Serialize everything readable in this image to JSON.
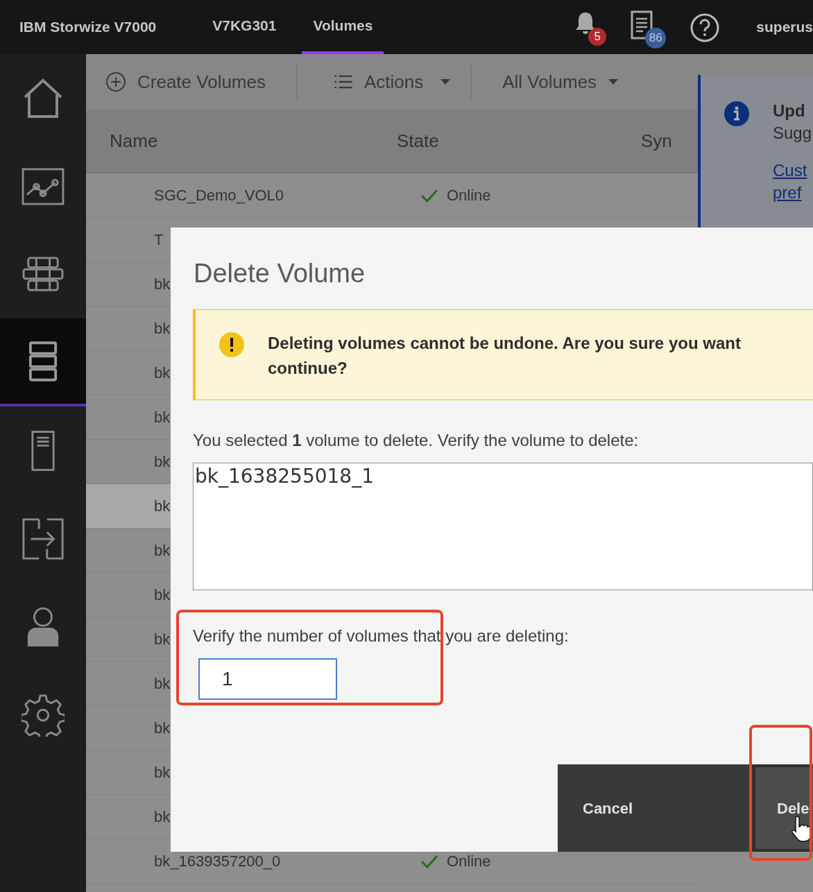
{
  "top_bar": {
    "product": "IBM Storwize V7000",
    "items": [
      {
        "label": "V7KG301",
        "selected": false
      },
      {
        "label": "Volumes",
        "selected": true
      }
    ],
    "notifications": "5",
    "tasks": "86",
    "user": "superus"
  },
  "sidebar": {
    "items": [
      {
        "kind": "home",
        "selected": false
      },
      {
        "kind": "monitoring",
        "selected": false
      },
      {
        "kind": "pools",
        "selected": false
      },
      {
        "kind": "volumes",
        "selected": true
      },
      {
        "kind": "hosts",
        "selected": false
      },
      {
        "kind": "copy",
        "selected": false
      },
      {
        "kind": "access",
        "selected": false
      },
      {
        "kind": "settings",
        "selected": false
      }
    ]
  },
  "toolbar": {
    "create": "Create Volumes",
    "actions": "Actions",
    "filter": "All Volumes"
  },
  "table": {
    "columns": [
      "Name",
      "State",
      "Syn"
    ],
    "rows": [
      {
        "name": "SGC_Demo_VOL0",
        "state": "Online",
        "selected": false
      },
      {
        "name": "T",
        "selected": false
      },
      {
        "name": "bk",
        "selected": false
      },
      {
        "name": "bk",
        "selected": false
      },
      {
        "name": "bk",
        "selected": false
      },
      {
        "name": "bk",
        "selected": false
      },
      {
        "name": "bk",
        "selected": false
      },
      {
        "name": "bk",
        "selected": true
      },
      {
        "name": "bk",
        "selected": false
      },
      {
        "name": "bk",
        "selected": false
      },
      {
        "name": "bk",
        "selected": false
      },
      {
        "name": "bk",
        "selected": false
      },
      {
        "name": "bk",
        "selected": false
      },
      {
        "name": "bk",
        "selected": false
      },
      {
        "name": "bk",
        "selected": false
      },
      {
        "name": "bk_1639357200_0",
        "state": "Online",
        "selected": false
      }
    ]
  },
  "notice": {
    "title": "Upd",
    "text": "Sugg",
    "link_lines": [
      "Cust",
      "pref"
    ]
  },
  "dialog": {
    "title": "Delete Volume",
    "warning_lines": [
      "Deleting volumes cannot be undone. Are you sure you want",
      "continue?"
    ],
    "selected_text": "You selected **1** volume to delete. Verify the volume to delete:",
    "volume_list": "bk_1638255018_1",
    "verify_label": "Verify the number of volumes that you are deleting:",
    "verify_value": "1",
    "buttons": [
      {
        "kind": "cancel",
        "label": "Cancel"
      },
      {
        "kind": "delete",
        "label": "Dele"
      }
    ]
  }
}
